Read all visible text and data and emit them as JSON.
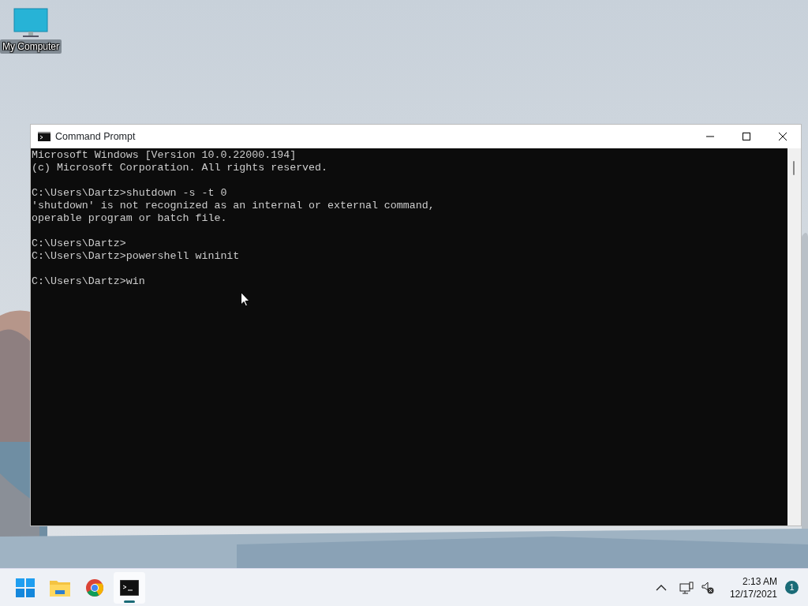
{
  "desktop_icons": [
    {
      "label": "My Computer"
    }
  ],
  "window": {
    "title": "Command Prompt",
    "console_blocks": [
      [
        "Microsoft Windows [Version 10.0.22000.194]",
        "(c) Microsoft Corporation. All rights reserved."
      ],
      [
        "C:\\Users\\Dartz>shutdown -s -t 0",
        "'shutdown' is not recognized as an internal or external command,",
        "operable program or batch file."
      ],
      [
        "C:\\Users\\Dartz>",
        "C:\\Users\\Dartz>powershell wininit"
      ],
      [
        "C:\\Users\\Dartz>win"
      ]
    ]
  },
  "taskbar": {
    "apps": [
      {
        "kind": "start",
        "selected": false
      },
      {
        "kind": "explorer",
        "selected": false
      },
      {
        "kind": "browser",
        "selected": false
      },
      {
        "kind": "terminal",
        "selected": true
      }
    ],
    "tray": {
      "time": "2:13 AM",
      "date": "12/17/2021",
      "notification_count": "1"
    }
  }
}
